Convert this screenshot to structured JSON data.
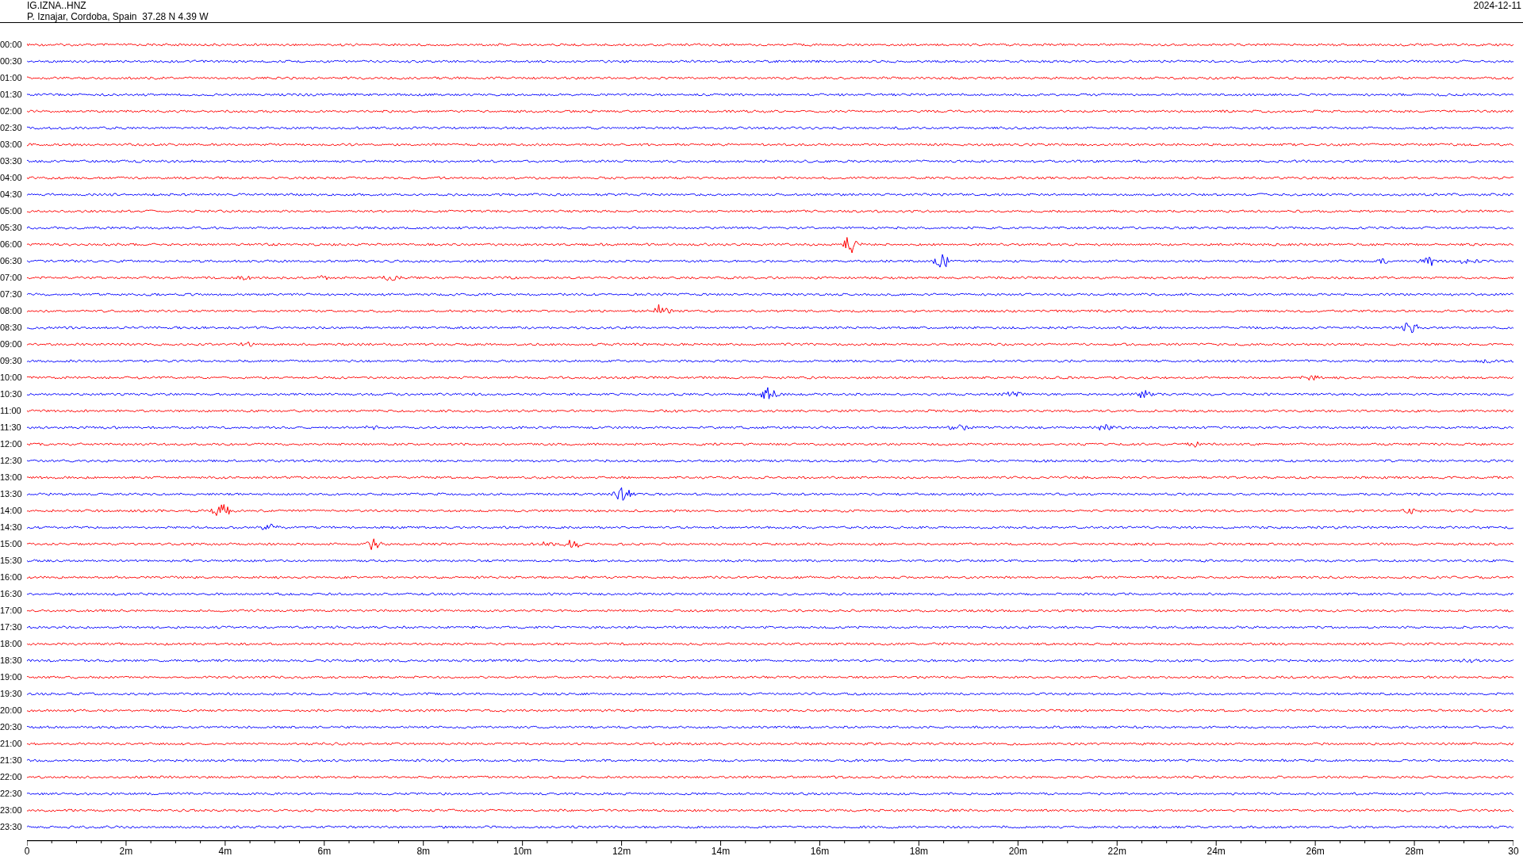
{
  "header": {
    "station": "IG.IZNA..HNZ",
    "location": "P. Iznajar, Cordoba, Spain  37.28 N 4.39 W",
    "date": "2024-12-11"
  },
  "rows": [
    {
      "time": "00:00",
      "color": "#ff0000"
    },
    {
      "time": "00:30",
      "color": "#0000ff"
    },
    {
      "time": "01:00",
      "color": "#ff0000"
    },
    {
      "time": "01:30",
      "color": "#0000ff"
    },
    {
      "time": "02:00",
      "color": "#ff0000"
    },
    {
      "time": "02:30",
      "color": "#0000ff"
    },
    {
      "time": "03:00",
      "color": "#ff0000"
    },
    {
      "time": "03:30",
      "color": "#0000ff"
    },
    {
      "time": "04:00",
      "color": "#ff0000"
    },
    {
      "time": "04:30",
      "color": "#0000ff"
    },
    {
      "time": "05:00",
      "color": "#ff0000"
    },
    {
      "time": "05:30",
      "color": "#0000ff"
    },
    {
      "time": "06:00",
      "color": "#ff0000"
    },
    {
      "time": "06:30",
      "color": "#0000ff"
    },
    {
      "time": "07:00",
      "color": "#ff0000"
    },
    {
      "time": "07:30",
      "color": "#0000ff"
    },
    {
      "time": "08:00",
      "color": "#ff0000"
    },
    {
      "time": "08:30",
      "color": "#0000ff"
    },
    {
      "time": "09:00",
      "color": "#ff0000"
    },
    {
      "time": "09:30",
      "color": "#0000ff"
    },
    {
      "time": "10:00",
      "color": "#ff0000"
    },
    {
      "time": "10:30",
      "color": "#0000ff"
    },
    {
      "time": "11:00",
      "color": "#ff0000"
    },
    {
      "time": "11:30",
      "color": "#0000ff"
    },
    {
      "time": "12:00",
      "color": "#ff0000"
    },
    {
      "time": "12:30",
      "color": "#0000ff"
    },
    {
      "time": "13:00",
      "color": "#ff0000"
    },
    {
      "time": "13:30",
      "color": "#0000ff"
    },
    {
      "time": "14:00",
      "color": "#ff0000"
    },
    {
      "time": "14:30",
      "color": "#0000ff"
    },
    {
      "time": "15:00",
      "color": "#ff0000"
    },
    {
      "time": "15:30",
      "color": "#0000ff"
    },
    {
      "time": "16:00",
      "color": "#ff0000"
    },
    {
      "time": "16:30",
      "color": "#0000ff"
    },
    {
      "time": "17:00",
      "color": "#ff0000"
    },
    {
      "time": "17:30",
      "color": "#0000ff"
    },
    {
      "time": "18:00",
      "color": "#ff0000"
    },
    {
      "time": "18:30",
      "color": "#0000ff"
    },
    {
      "time": "19:00",
      "color": "#ff0000"
    },
    {
      "time": "19:30",
      "color": "#0000ff"
    },
    {
      "time": "20:00",
      "color": "#ff0000"
    },
    {
      "time": "20:30",
      "color": "#0000ff"
    },
    {
      "time": "21:00",
      "color": "#ff0000"
    },
    {
      "time": "21:30",
      "color": "#0000ff"
    },
    {
      "time": "22:00",
      "color": "#ff0000"
    },
    {
      "time": "22:30",
      "color": "#0000ff"
    },
    {
      "time": "23:00",
      "color": "#ff0000"
    },
    {
      "time": "23:30",
      "color": "#0000ff"
    }
  ],
  "axis": {
    "labels": [
      "0",
      "2m",
      "4m",
      "6m",
      "8m",
      "10m",
      "12m",
      "14m",
      "16m",
      "18m",
      "20m",
      "22m",
      "24m",
      "26m",
      "28m",
      "30"
    ]
  }
}
